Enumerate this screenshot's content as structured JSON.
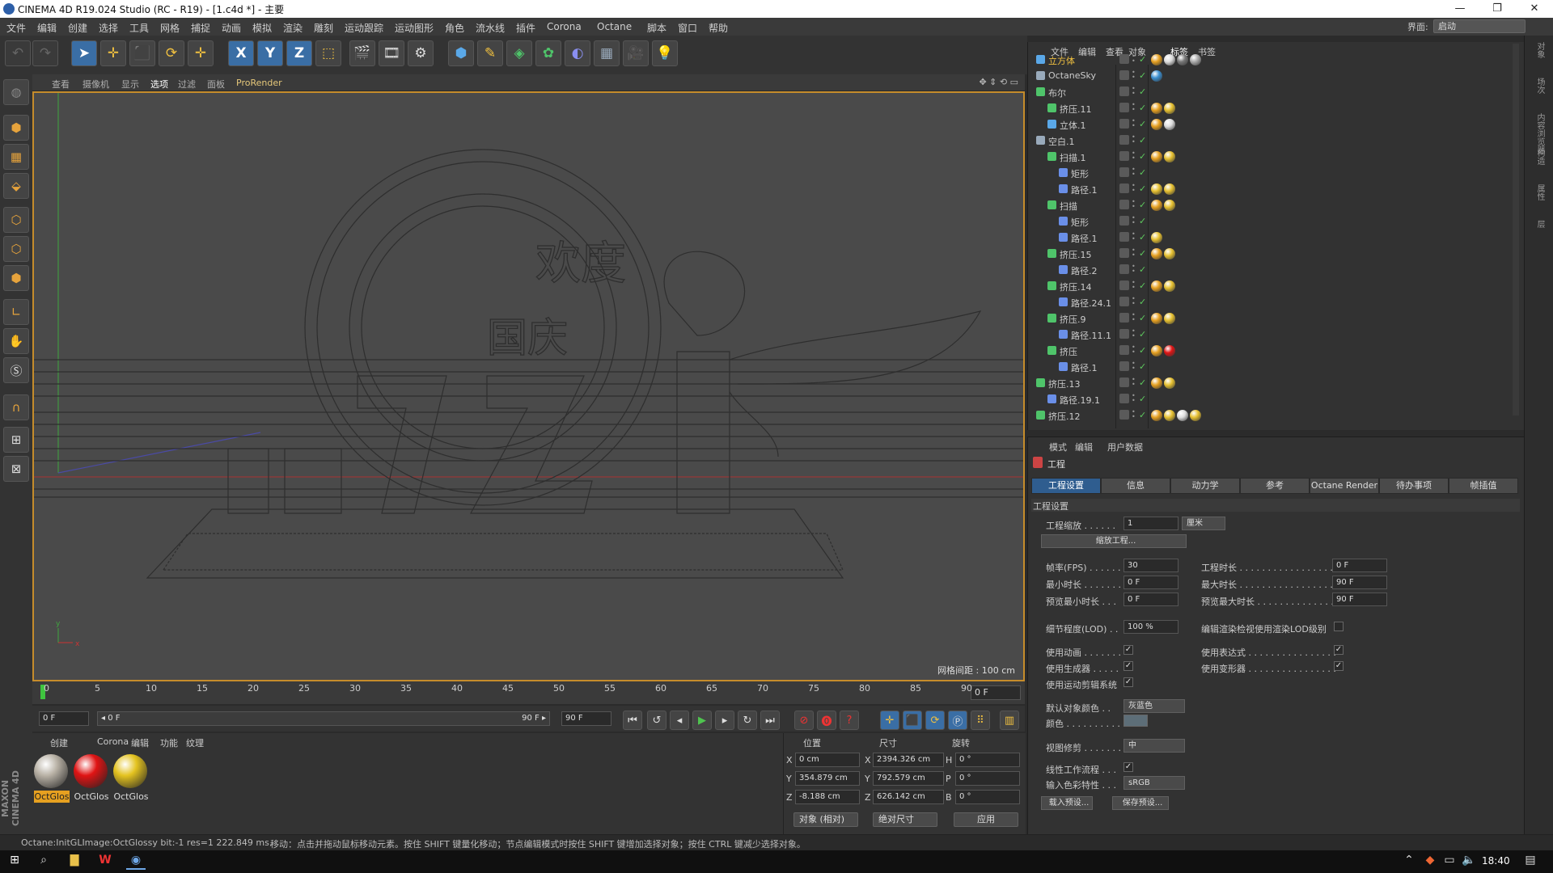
{
  "window": {
    "title": "CINEMA 4D R19.024 Studio (RC - R19) - [1.c4d *] - 主要",
    "min": "—",
    "max": "❐",
    "close": "✕"
  },
  "menu": {
    "items": [
      "文件",
      "编辑",
      "创建",
      "选择",
      "工具",
      "网格",
      "捕捉",
      "动画",
      "模拟",
      "渲染",
      "雕刻",
      "运动跟踪",
      "运动图形",
      "角色",
      "流水线",
      "插件",
      "Corona",
      "Octane",
      "脚本",
      "窗口",
      "帮助"
    ],
    "interface_label": "界面:",
    "interface_value": "启动"
  },
  "toolbar": {
    "icons": [
      "undo-icon",
      "redo-icon",
      "select-arrow-icon",
      "move-icon",
      "scale-icon",
      "rotate-icon",
      "live-select-icon",
      "x-axis-icon",
      "y-axis-icon",
      "z-axis-icon",
      "world-coord-icon",
      "render-view-icon",
      "render-picture-icon",
      "render-settings-icon",
      "cube-icon",
      "pen-icon",
      "subdivision-icon",
      "cloner-icon",
      "deformer-icon",
      "floor-icon",
      "camera-icon",
      "light-icon"
    ],
    "labels": {
      "x": "X",
      "y": "Y",
      "z": "Z"
    }
  },
  "viewport": {
    "menu": [
      "查看",
      "摄像机",
      "显示",
      "选项",
      "过滤",
      "面板",
      "ProRender"
    ],
    "grid_label": "网格间距 : 100 cm",
    "axis_x": "x",
    "axis_y": "y"
  },
  "timeline": {
    "ticks": [
      "0",
      "5",
      "10",
      "15",
      "20",
      "25",
      "30",
      "35",
      "40",
      "45",
      "50",
      "55",
      "60",
      "65",
      "70",
      "75",
      "80",
      "85",
      "90"
    ],
    "current_frame": "0 F"
  },
  "playbar": {
    "start": "0 F",
    "slider_start": "◂ 0 F",
    "slider_end": "90 F ▸",
    "end": "90 F"
  },
  "materials": {
    "menu": [
      "创建",
      "Corona",
      "编辑",
      "功能",
      "纹理"
    ],
    "items": [
      {
        "label": "OctGlos",
        "color": "#b9b2a6"
      },
      {
        "label": "OctGlos",
        "color": "#e01414"
      },
      {
        "label": "OctGlos",
        "color": "#e4c320"
      }
    ]
  },
  "coords": {
    "headers": [
      "位置",
      "尺寸",
      "旋转"
    ],
    "rows": [
      {
        "axis": "X",
        "pos": "0 cm",
        "saxis": "X",
        "size": "2394.326 cm",
        "raxis": "H",
        "rot": "0 °"
      },
      {
        "axis": "Y",
        "pos": "354.879 cm",
        "saxis": "Y",
        "size": "792.579 cm",
        "raxis": "P",
        "rot": "0 °"
      },
      {
        "axis": "Z",
        "pos": "-8.188 cm",
        "saxis": "Z",
        "size": "626.142 cm",
        "raxis": "B",
        "rot": "0 °"
      }
    ],
    "mode1": "对象 (相对)",
    "mode2": "绝对尺寸",
    "apply": "应用"
  },
  "status": {
    "left": "Octane:InitGLImage:OctGlossy  bit:-1 res=1  222.849 ms.",
    "right": "移动：点击并拖动鼠标移动元素。按住 SHIFT 键量化移动；节点编辑模式时按住 SHIFT 键增加选择对象；按住 CTRL 键减少选择对象。"
  },
  "taskbar": {
    "time": "18:40"
  },
  "objects": {
    "menu": [
      "文件",
      "编辑",
      "查看",
      "对象",
      "标签",
      "书签"
    ],
    "rows": [
      {
        "name": "立方体",
        "indent": 0,
        "type": "cube",
        "selected": true
      },
      {
        "name": "OctaneSky",
        "indent": 0,
        "type": "sky"
      },
      {
        "name": "布尔",
        "indent": 0,
        "type": "bool"
      },
      {
        "name": "挤压.11",
        "indent": 1,
        "type": "extrude"
      },
      {
        "name": "立体.1",
        "indent": 1,
        "type": "cube"
      },
      {
        "name": "空白.1",
        "indent": 0,
        "type": "null"
      },
      {
        "name": "扫描.1",
        "indent": 1,
        "type": "sweep"
      },
      {
        "name": "矩形",
        "indent": 2,
        "type": "spline"
      },
      {
        "name": "路径.1",
        "indent": 2,
        "type": "path"
      },
      {
        "name": "扫描",
        "indent": 1,
        "type": "sweep"
      },
      {
        "name": "矩形",
        "indent": 2,
        "type": "spline"
      },
      {
        "name": "路径.1",
        "indent": 2,
        "type": "path"
      },
      {
        "name": "挤压.15",
        "indent": 1,
        "type": "extrude"
      },
      {
        "name": "路径.2",
        "indent": 2,
        "type": "path"
      },
      {
        "name": "挤压.14",
        "indent": 1,
        "type": "extrude"
      },
      {
        "name": "路径.24.1",
        "indent": 2,
        "type": "path"
      },
      {
        "name": "挤压.9",
        "indent": 1,
        "type": "extrude"
      },
      {
        "name": "路径.11.1",
        "indent": 2,
        "type": "path"
      },
      {
        "name": "挤压",
        "indent": 1,
        "type": "extrude"
      },
      {
        "name": "路径.1",
        "indent": 2,
        "type": "path"
      },
      {
        "name": "挤压.13",
        "indent": 0,
        "type": "extrude"
      },
      {
        "name": "路径.19.1",
        "indent": 1,
        "type": "path"
      },
      {
        "name": "挤压.12",
        "indent": 0,
        "type": "extrude"
      }
    ]
  },
  "attributes": {
    "menu": [
      "模式",
      "编辑",
      "用户数据"
    ],
    "title": "工程",
    "tabs": [
      "工程设置",
      "信息",
      "动力学",
      "参考",
      "Octane Render",
      "待办事项",
      "帧插值"
    ],
    "section": "工程设置",
    "scale_label": "工程缩放 . . . . . .",
    "scale_value": "1",
    "scale_unit": "厘米",
    "scale_btn": "缩放工程...",
    "fps_label": "帧率(FPS) . . . . . .",
    "fps": "30",
    "dur_label": "工程时长 . . . . . . . . . . . . . . . . .",
    "dur": "0 F",
    "min_label": "最小时长 . . . . . . .",
    "min": "0 F",
    "max_label": "最大时长 . . . . . . . . . . . . . . . . .",
    "max": "90 F",
    "pmin_label": "预览最小时长 . . .",
    "pmin": "0 F",
    "pmax_label": "预览最大时长 . . . . . . . . . . . . . .",
    "pmax": "90 F",
    "lod_label": "细节程度(LOD) . .",
    "lod": "100 %",
    "lod_edit_label": "编辑渲染检视使用渲染LOD级别",
    "anim_label": "使用动画 . . . . . . .",
    "expr_label": "使用表达式 . . . . . . . . . . . . . . . .",
    "gen_label": "使用生成器 . . . . .",
    "def_label": "使用变形器 . . . . . . . . . . . . . . . .",
    "mo_label": "使用运动剪辑系统",
    "defcolor_label": "默认对象颜色 . .",
    "defcolor": "灰蓝色",
    "color_label": "颜色 . . . . . . . . . .",
    "clip_label": "视图修剪 . . . . . . .",
    "clip": "中",
    "linear_label": "线性工作流程 . . .",
    "input_label": "输入色彩特性 . . .",
    "input": "sRGB",
    "load_btn": "载入预设...",
    "save_btn": "保存预设...",
    "check": "✓"
  },
  "rightstrip": [
    "对象",
    "场次",
    "内容浏览器",
    "构造",
    "属性",
    "层"
  ]
}
